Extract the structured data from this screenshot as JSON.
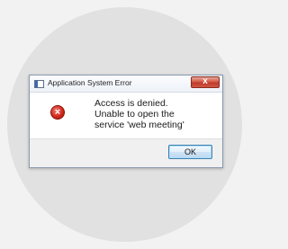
{
  "dialog": {
    "title": "Application System Error",
    "close_symbol": "x",
    "icon": "error-icon",
    "error_symbol": "×",
    "message_lines": [
      "Access is denied.",
      "Unable to open the",
      "service 'web meeting'"
    ],
    "ok_label": "OK"
  },
  "colors": {
    "background": "#f2f2f2",
    "circle": "#e1e1e1",
    "close_button": "#c0392b",
    "error_icon": "#d3291c",
    "ok_border": "#3c7fb1"
  }
}
